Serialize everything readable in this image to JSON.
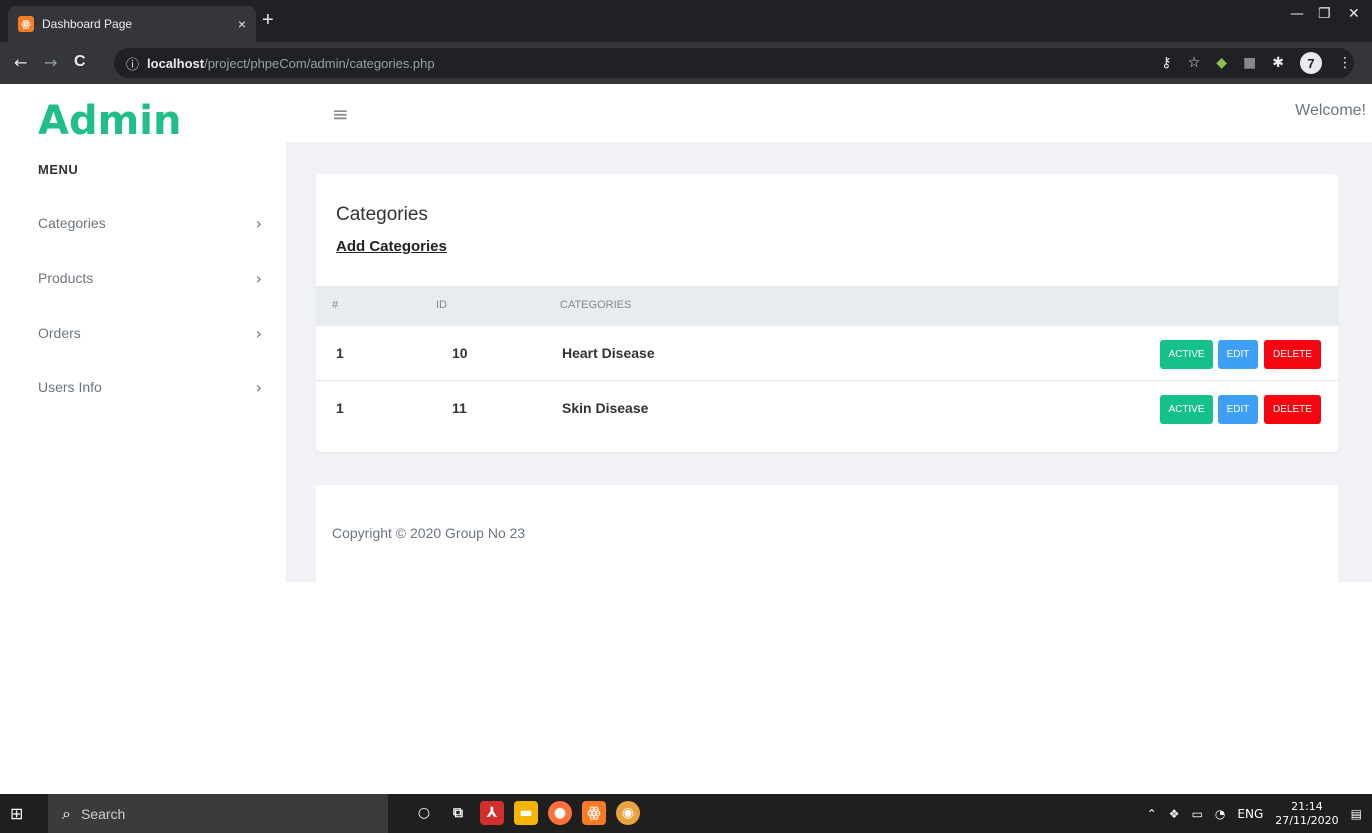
{
  "browser": {
    "tab_title": "Dashboard Page",
    "tab_close": "×",
    "new_tab": "+",
    "url_host": "localhost",
    "url_path": "/project/phpeCom/admin/categories.php",
    "window_controls": {
      "minimize": "—",
      "restore": "❐",
      "close": "✕"
    },
    "nav": {
      "back": "←",
      "forward": "→",
      "reload": "C",
      "info": "ⓘ"
    },
    "profile_initial": "7"
  },
  "sidebar": {
    "logo": "Admin",
    "menu_title": "MENU",
    "items": [
      {
        "label": "Categories"
      },
      {
        "label": "Products"
      },
      {
        "label": "Orders"
      },
      {
        "label": "Users Info"
      }
    ]
  },
  "topbar": {
    "welcome": "Welcome!"
  },
  "card": {
    "title": "Categories",
    "add_link": "Add Categories",
    "table": {
      "headers": [
        "#",
        "ID",
        "CATEGORIES"
      ],
      "rows": [
        {
          "num": "1",
          "id": "10",
          "name": "Heart Disease"
        },
        {
          "num": "1",
          "id": "11",
          "name": "Skin Disease"
        }
      ],
      "actions": {
        "active": "ACTIVE",
        "edit": "EDIT",
        "delete": "DELETE"
      }
    }
  },
  "footer": {
    "copyright": "Copyright © 2020 Group No 23"
  },
  "taskbar": {
    "search_placeholder": "Search",
    "language": "ENG",
    "time": "21:14",
    "date": "27/11/2020"
  },
  "colors": {
    "brand": "#1fbe8b",
    "active": "#16c08a",
    "edit": "#3d9ff5",
    "delete": "#f5050f"
  }
}
